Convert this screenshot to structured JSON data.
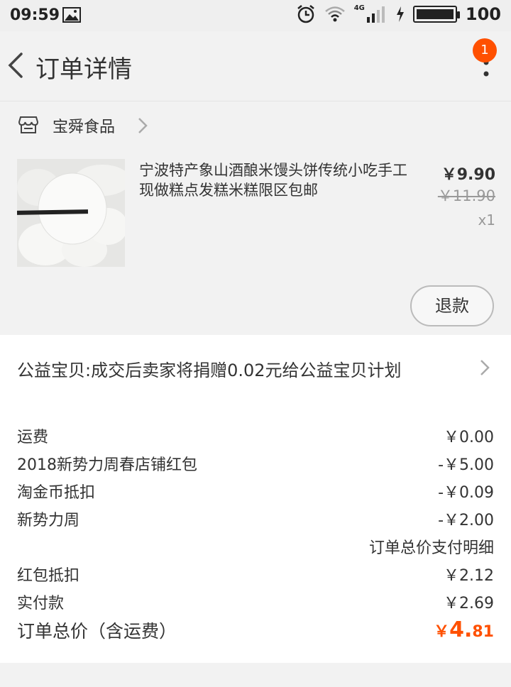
{
  "status": {
    "time": "09:59",
    "network": "4G",
    "battery": "100",
    "battery_level": 1.0
  },
  "nav": {
    "title": "订单详情",
    "badge": "1"
  },
  "shop": {
    "name": "宝舜食品"
  },
  "product": {
    "title": "宁波特产象山酒酿米馒头饼传统小吃手工现做糕点发糕米糕限区包邮",
    "price": "￥9.90",
    "original_price": "￥11.90",
    "quantity": "x1",
    "refund_label": "退款"
  },
  "charity": {
    "text": "公益宝贝:成交后卖家将捐赠0.02元给公益宝贝计划"
  },
  "summary": {
    "rows": [
      {
        "label": "运费",
        "value": "￥0.00"
      },
      {
        "label": "2018新势力周春店铺红包",
        "value": "-￥5.00"
      },
      {
        "label": "淘金币抵扣",
        "value": "-￥0.09"
      },
      {
        "label": "新势力周",
        "value": "-￥2.00"
      },
      {
        "label": "",
        "value": "订单总价支付明细"
      },
      {
        "label": "红包抵扣",
        "value": "￥2.12"
      },
      {
        "label": "实付款",
        "value": "￥2.69"
      }
    ],
    "total_label": "订单总价（含运费）",
    "total_currency": "￥",
    "total_int": "4.",
    "total_dec": "81"
  },
  "colors": {
    "accent": "#ff5000",
    "background": "#f2f2f2",
    "card": "#ffffff"
  }
}
